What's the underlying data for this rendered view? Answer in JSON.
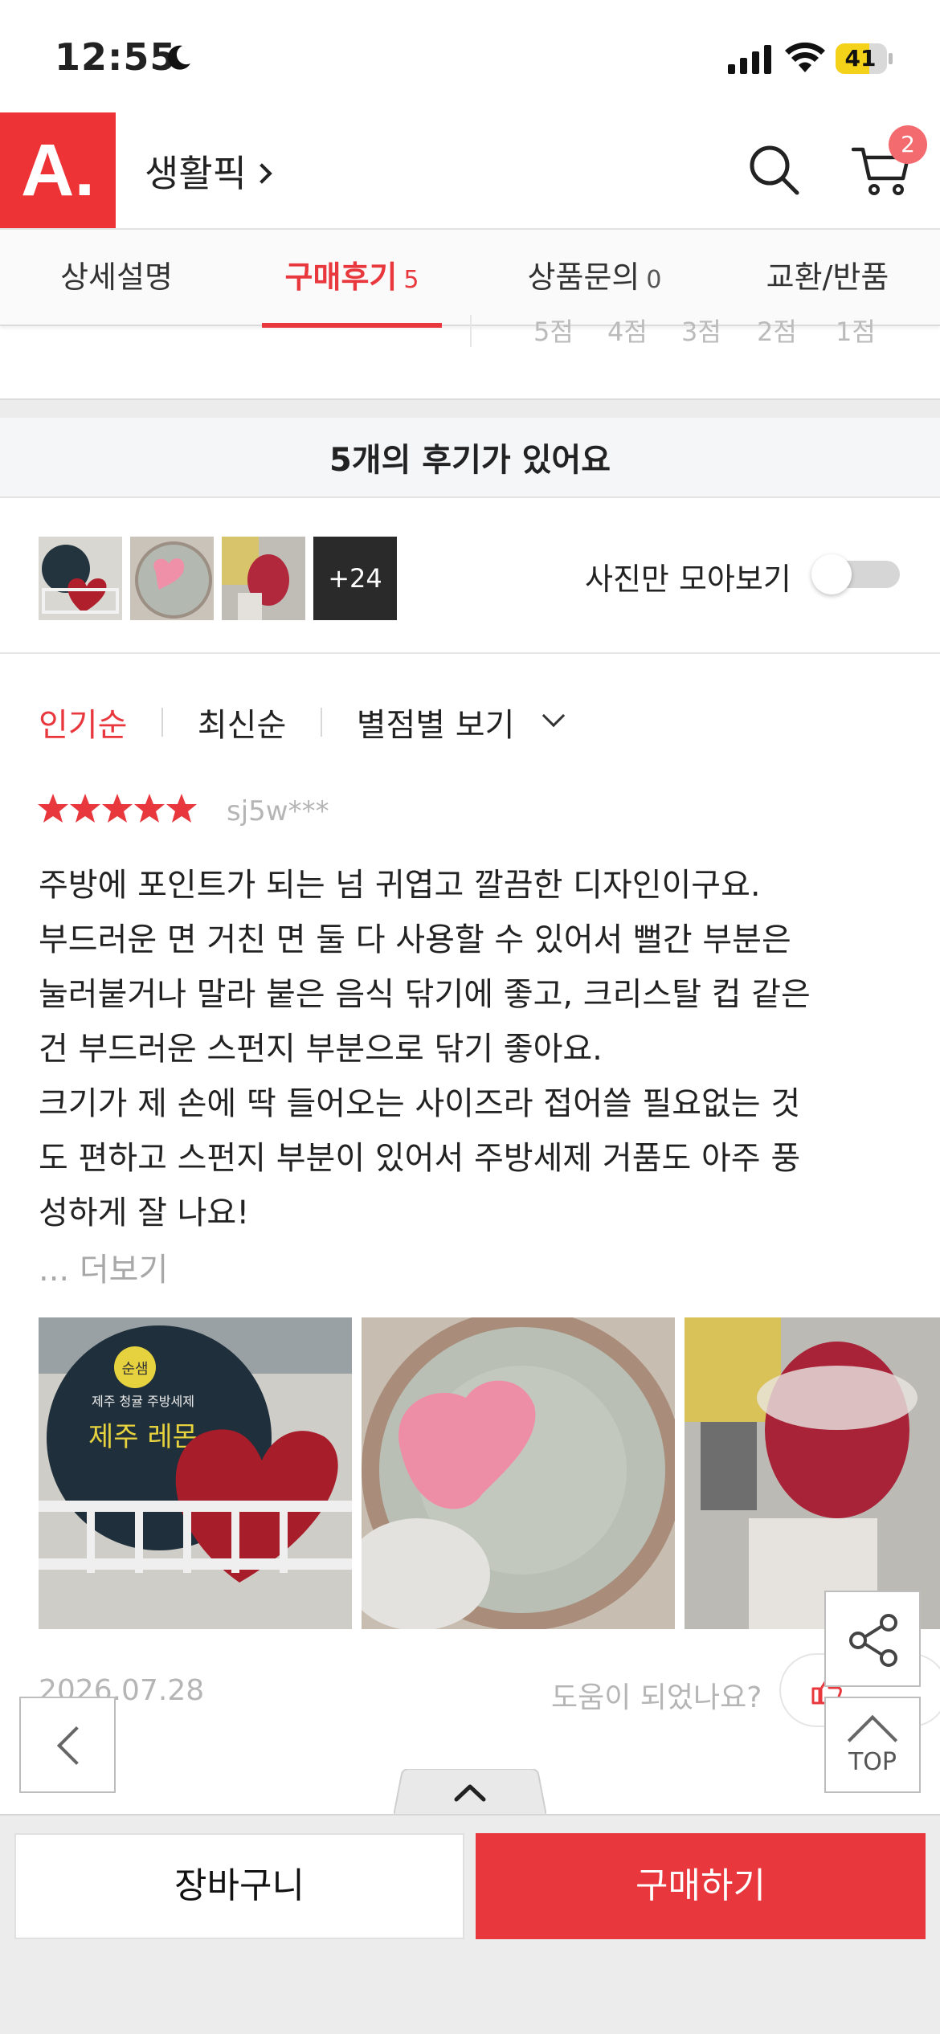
{
  "status_bar": {
    "time": "12:55",
    "battery": "41"
  },
  "header": {
    "logo": "A.",
    "breadcrumb": "생활픽",
    "cart_count": "2"
  },
  "tabs": [
    {
      "label": "상세설명",
      "count": ""
    },
    {
      "label": "구매후기",
      "count": "5"
    },
    {
      "label": "상품문의",
      "count": "0"
    },
    {
      "label": "교환/반품",
      "count": ""
    }
  ],
  "rating_axis": [
    "5점",
    "4점",
    "3점",
    "2점",
    "1점"
  ],
  "reviews_summary": {
    "title": "5개의 후기가 있어요"
  },
  "photo_strip": {
    "more_count": "+24",
    "toggle_label": "사진만 모아보기",
    "toggle_on": false
  },
  "sort": {
    "popular": "인기순",
    "latest": "최신순",
    "by_rating": "별점별 보기"
  },
  "review": {
    "stars": 5,
    "reviewer": "sj5w***",
    "body": "주방에 포인트가 되는 넘 귀엽고 깔끔한 디자인이구요.\n부드러운 면 거친 면 둘 다 사용할 수 있어서 뻘간 부분은\n눌러붙거나 말라 붙은 음식 닦기에 좋고, 크리스탈 컵 같은\n건 부드러운 스펀지 부분으로 닦기 좋아요.\n크기가 제 손에 딱 들어오는 사이즈라 접어쓸 필요없는 것\n도 편하고 스펀지 부분이 있어서 주방세제 거품도 아주 풍\n성하게 잘 나요!",
    "more": "... 더보기",
    "date": "2026.07.28",
    "helpful_question": "도움이 되었나요?",
    "photo_caption_1": "제주 레몬",
    "photo_caption_2": "제주 청귤 주방세제"
  },
  "floating": {
    "top_label": "TOP"
  },
  "bottom_bar": {
    "cart_label": "장바구니",
    "buy_label": "구매하기"
  },
  "colors": {
    "accent": "#e8373d",
    "logo_bg": "#ee3336",
    "badge": "#f36a6f"
  }
}
